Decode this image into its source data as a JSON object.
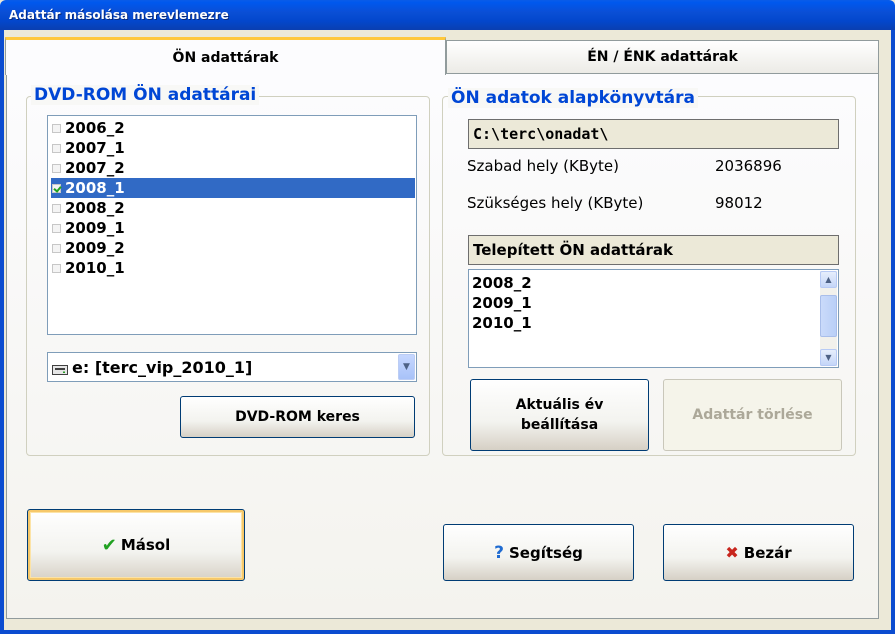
{
  "window": {
    "title": "Adattár másolása merevlemezre"
  },
  "tabs": [
    {
      "label": "ÖN adattárak",
      "active": true
    },
    {
      "label": "ÉN / ÉNK adattárak",
      "active": false
    }
  ],
  "dvd_group": {
    "title": "DVD-ROM ÖN adattárai",
    "items": [
      {
        "label": "2006_2",
        "checked": false
      },
      {
        "label": "2007_1",
        "checked": false
      },
      {
        "label": "2007_2",
        "checked": false
      },
      {
        "label": "2008_1",
        "checked": true
      },
      {
        "label": "2008_2",
        "checked": false
      },
      {
        "label": "2009_1",
        "checked": false
      },
      {
        "label": "2009_2",
        "checked": false
      },
      {
        "label": "2010_1",
        "checked": false
      }
    ],
    "selected_index": 3,
    "drive_combo_value": "e: [terc_vip_2010_1]",
    "search_button": "DVD-ROM keres"
  },
  "local_group": {
    "title": "ÖN adatok alapkönyvtára",
    "path": "C:\\terc\\onadat\\",
    "free_label": "Szabad hely (KByte)",
    "free_value": "2036896",
    "required_label": "Szükséges hely (KByte)",
    "required_value": "98012",
    "installed_title": "Telepített ÖN adattárak",
    "installed_items": [
      "2008_2",
      "2009_1",
      "2010_1"
    ],
    "set_year_button": "Aktuális év beállítása",
    "delete_button": "Adattár törlése"
  },
  "footer": {
    "copy_button": "Másol",
    "help_button": "Segítség",
    "close_button": "Bezár"
  },
  "colors": {
    "title_bar": "#0A4FD6",
    "legend_text": "#0046D5",
    "selection": "#316AC5",
    "ok_check": "#21A121",
    "close_x": "#C8261E",
    "help_q": "#1F6BD1"
  }
}
